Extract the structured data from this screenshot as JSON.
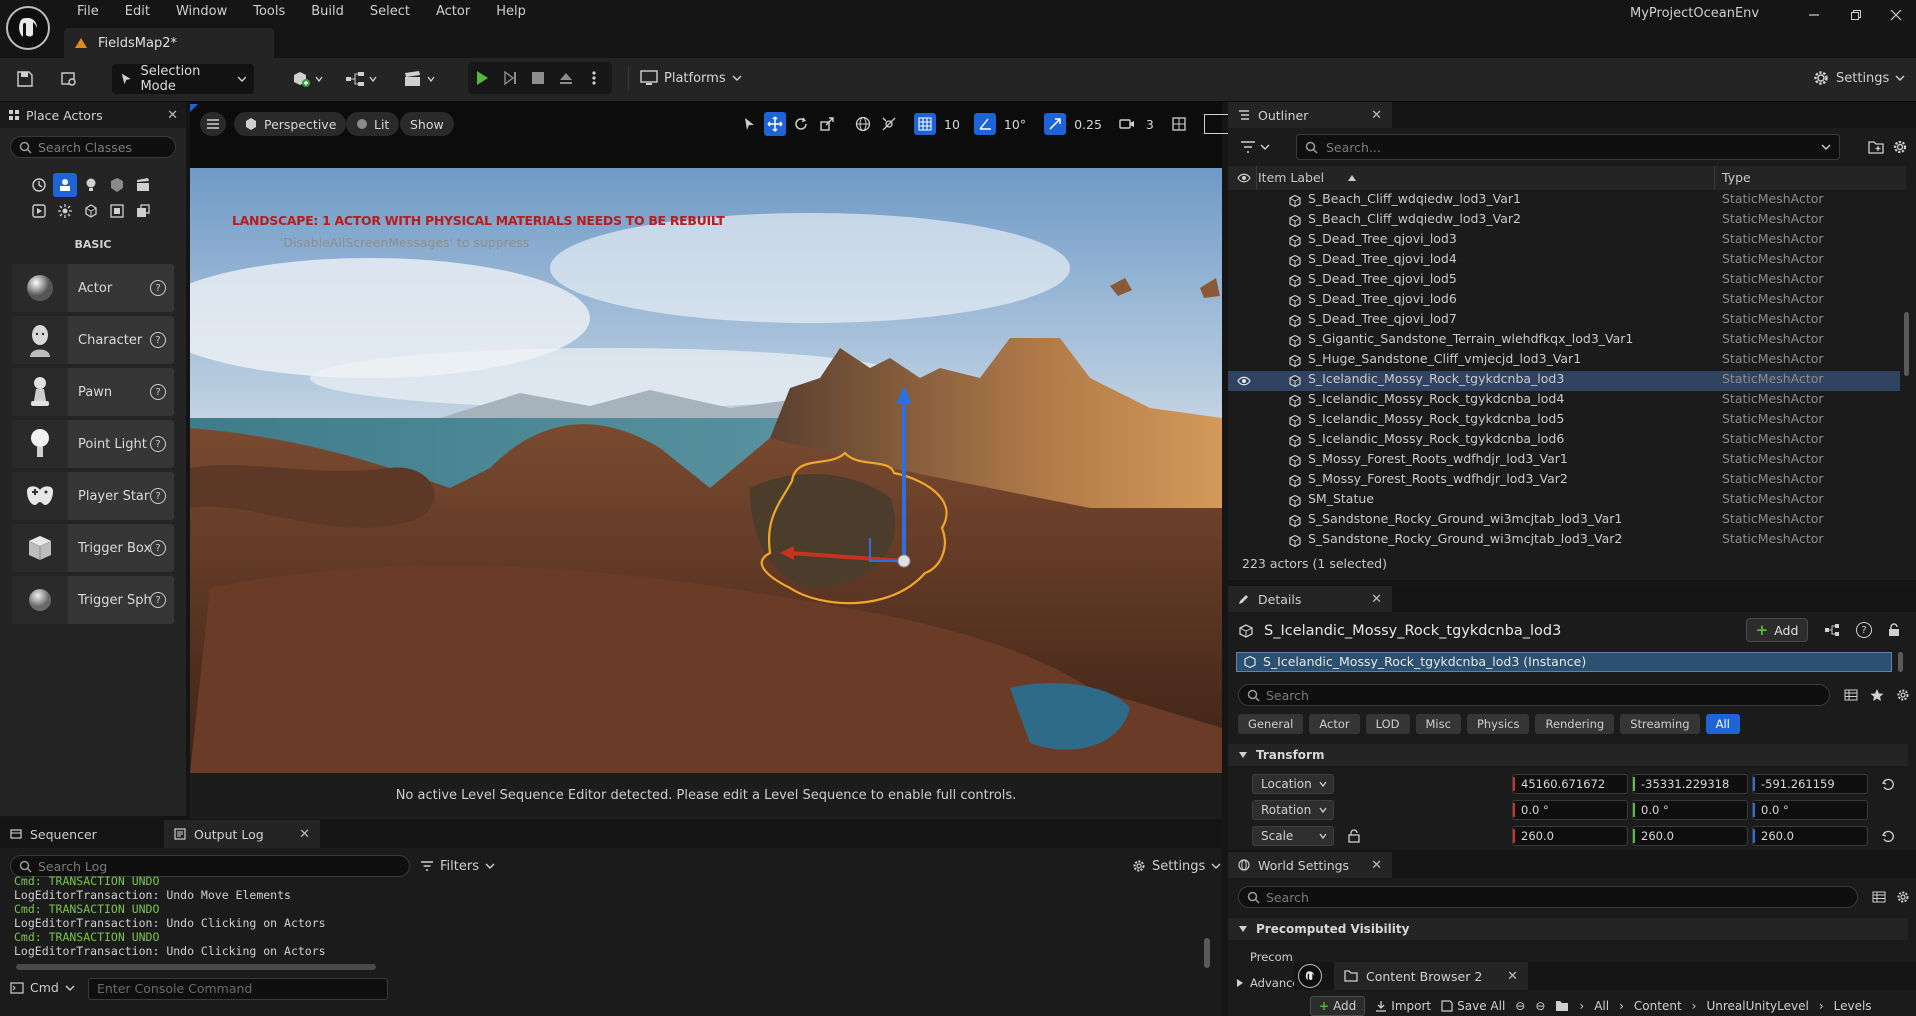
{
  "menu": [
    "File",
    "Edit",
    "Window",
    "Tools",
    "Build",
    "Select",
    "Actor",
    "Help"
  ],
  "document_tab": "FieldsMap2*",
  "project_name": "MyProjectOceanEnv",
  "toolbar": {
    "selection_mode": "Selection Mode",
    "platforms": "Platforms",
    "settings": "Settings"
  },
  "place_actors": {
    "title": "Place Actors",
    "search_placeholder": "Search Classes",
    "section": "BASIC",
    "items": [
      {
        "label": "Actor",
        "icon": "sphere-icon"
      },
      {
        "label": "Character",
        "icon": "character-icon"
      },
      {
        "label": "Pawn",
        "icon": "pawn-icon"
      },
      {
        "label": "Point Light",
        "icon": "point-light-icon"
      },
      {
        "label": "Player Start",
        "icon": "player-start-icon"
      },
      {
        "label": "Trigger Box",
        "icon": "trigger-box-icon"
      },
      {
        "label": "Trigger Sphere",
        "icon": "trigger-sphere-icon"
      }
    ]
  },
  "viewport": {
    "perspective": "Perspective",
    "lit": "Lit",
    "show": "Show",
    "grid_snap": "10",
    "rotation_snap": "10°",
    "scale_snap": "0.25",
    "camera_speed": "3",
    "warning": "LANDSCAPE: 1 ACTOR WITH PHYSICAL MATERIALS NEEDS TO BE REBUILT",
    "suppress_hint": "'DisableAllScreenMessages' to suppress",
    "sequencer_message": "No active Level Sequence Editor detected. Please edit a Level Sequence to enable full controls."
  },
  "outliner": {
    "title": "Outliner",
    "search_placeholder": "Search...",
    "col_label": "Item Label",
    "col_type": "Type",
    "rows": [
      {
        "name": "S_Beach_Cliff_wdqiedw_lod3_Var1",
        "type": "StaticMeshActor"
      },
      {
        "name": "S_Beach_Cliff_wdqiedw_lod3_Var2",
        "type": "StaticMeshActor"
      },
      {
        "name": "S_Dead_Tree_qjovi_lod3",
        "type": "StaticMeshActor"
      },
      {
        "name": "S_Dead_Tree_qjovi_lod4",
        "type": "StaticMeshActor"
      },
      {
        "name": "S_Dead_Tree_qjovi_lod5",
        "type": "StaticMeshActor"
      },
      {
        "name": "S_Dead_Tree_qjovi_lod6",
        "type": "StaticMeshActor"
      },
      {
        "name": "S_Dead_Tree_qjovi_lod7",
        "type": "StaticMeshActor"
      },
      {
        "name": "S_Gigantic_Sandstone_Terrain_wlehdfkqx_lod3_Var1",
        "type": "StaticMeshActor"
      },
      {
        "name": "S_Huge_Sandstone_Cliff_vmjecjd_lod3_Var1",
        "type": "StaticMeshActor"
      },
      {
        "name": "S_Icelandic_Mossy_Rock_tgykdcnba_lod3",
        "type": "StaticMeshActor"
      },
      {
        "name": "S_Icelandic_Mossy_Rock_tgykdcnba_lod4",
        "type": "StaticMeshActor"
      },
      {
        "name": "S_Icelandic_Mossy_Rock_tgykdcnba_lod5",
        "type": "StaticMeshActor"
      },
      {
        "name": "S_Icelandic_Mossy_Rock_tgykdcnba_lod6",
        "type": "StaticMeshActor"
      },
      {
        "name": "S_Mossy_Forest_Roots_wdfhdjr_lod3_Var1",
        "type": "StaticMeshActor"
      },
      {
        "name": "S_Mossy_Forest_Roots_wdfhdjr_lod3_Var2",
        "type": "StaticMeshActor"
      },
      {
        "name": "SM_Statue",
        "type": "StaticMeshActor"
      },
      {
        "name": "S_Sandstone_Rocky_Ground_wi3mcjtab_lod3_Var1",
        "type": "StaticMeshActor"
      },
      {
        "name": "S_Sandstone_Rocky_Ground_wi3mcjtab_lod3_Var2",
        "type": "StaticMeshActor"
      }
    ],
    "count": "223 actors (1 selected)"
  },
  "details": {
    "title": "Details",
    "actor_name": "S_Icelandic_Mossy_Rock_tgykdcnba_lod3",
    "add": "Add",
    "instance": "S_Icelandic_Mossy_Rock_tgykdcnba_lod3 (Instance)",
    "search_placeholder": "Search",
    "tabs": [
      "General",
      "Actor",
      "LOD",
      "Misc",
      "Physics",
      "Rendering",
      "Streaming",
      "All"
    ],
    "transform_label": "Transform",
    "location": {
      "label": "Location",
      "x": "45160.671672",
      "y": "-35331.229318",
      "z": "-591.261159"
    },
    "rotation": {
      "label": "Rotation",
      "x": "0.0 °",
      "y": "0.0 °",
      "z": "0.0 °"
    },
    "scale": {
      "label": "Scale",
      "x": "260.0",
      "y": "260.0",
      "z": "260.0"
    }
  },
  "world_settings": {
    "title": "World Settings",
    "search_placeholder": "Search",
    "section": "Precomputed Visibility",
    "row1": "Precomputed Visibility",
    "row2": "Advanced"
  },
  "content_browser": {
    "title": "Content Browser 2",
    "add": "Add",
    "import": "Import",
    "save_all": "Save All",
    "path": [
      "All",
      "Content",
      "UnrealUnityLevel",
      "Levels"
    ]
  },
  "bottom": {
    "sequencer_tab": "Sequencer",
    "output_tab": "Output Log",
    "search_placeholder": "Search Log",
    "filters": "Filters",
    "settings": "Settings",
    "log_lines": [
      {
        "text": "Cmd: TRANSACTION UNDO",
        "kind": "cmd"
      },
      {
        "text": "LogEditorTransaction: Undo Move Elements",
        "kind": "log"
      },
      {
        "text": "Cmd: TRANSACTION UNDO",
        "kind": "cmd"
      },
      {
        "text": "LogEditorTransaction: Undo Clicking on Actors",
        "kind": "log"
      },
      {
        "text": "Cmd: TRANSACTION UNDO",
        "kind": "cmd"
      },
      {
        "text": "LogEditorTransaction: Undo Clicking on Actors",
        "kind": "log"
      }
    ],
    "cmd_label": "Cmd",
    "console_placeholder": "Enter Console Command"
  }
}
